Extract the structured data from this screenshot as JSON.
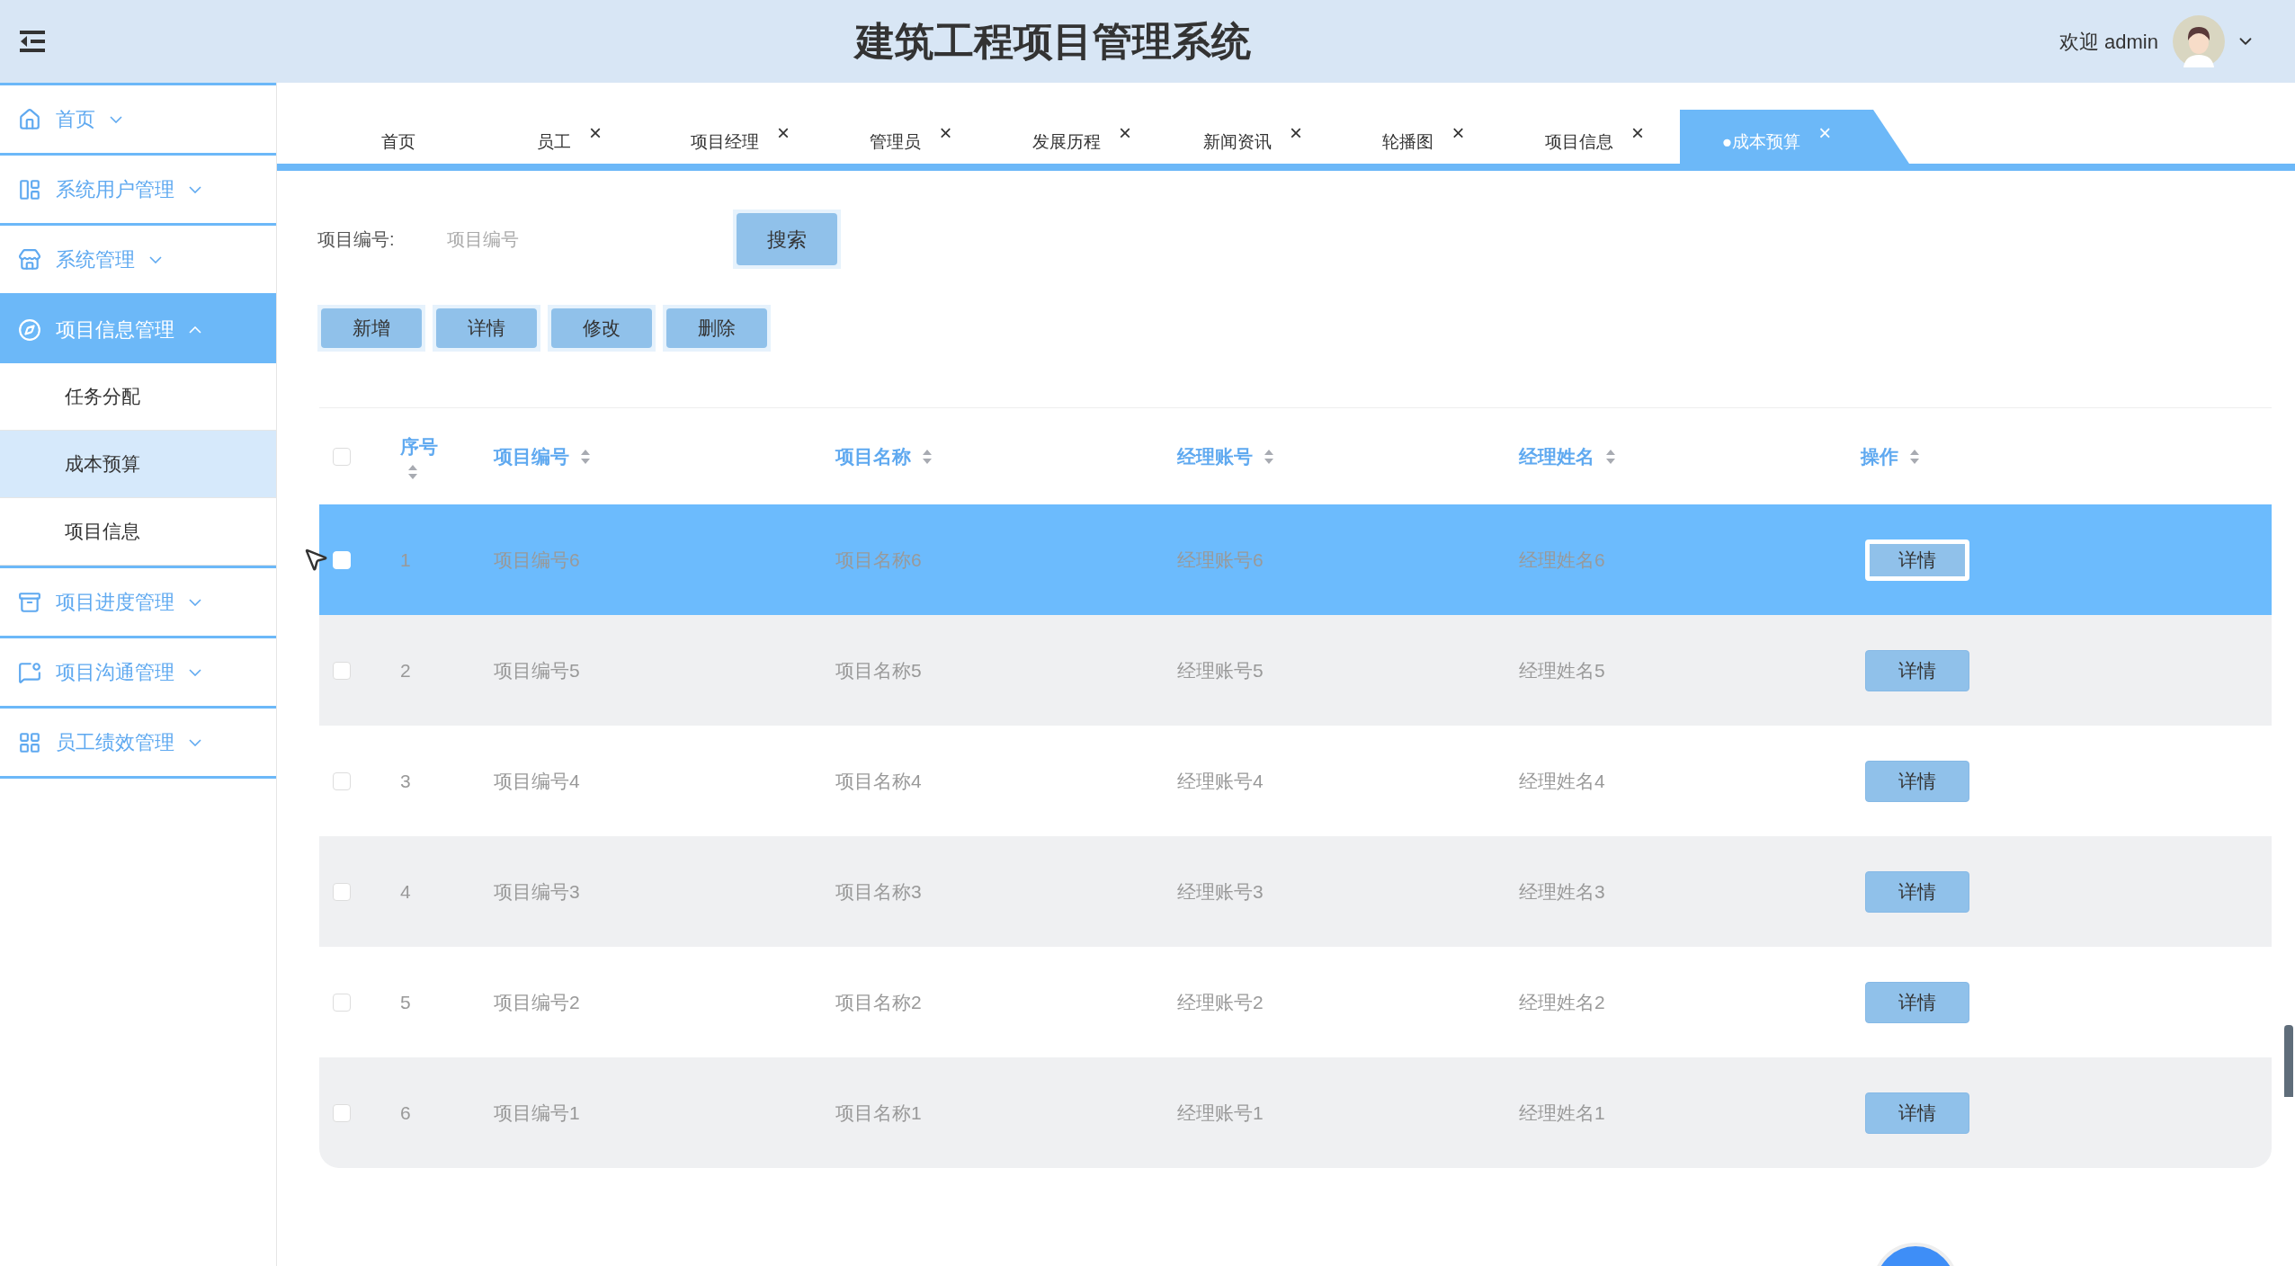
{
  "header": {
    "title": "建筑工程项目管理系统",
    "greeting": "欢迎 admin"
  },
  "sidebar": {
    "items": [
      {
        "label": "首页",
        "expanded": false
      },
      {
        "label": "系统用户管理",
        "expanded": false
      },
      {
        "label": "系统管理",
        "expanded": false
      },
      {
        "label": "项目信息管理",
        "expanded": true,
        "children": [
          {
            "label": "任务分配",
            "selected": false
          },
          {
            "label": "成本预算",
            "selected": true
          },
          {
            "label": "项目信息",
            "selected": false
          }
        ]
      },
      {
        "label": "项目进度管理",
        "expanded": false
      },
      {
        "label": "项目沟通管理",
        "expanded": false
      },
      {
        "label": "员工绩效管理",
        "expanded": false
      }
    ]
  },
  "tabs": [
    {
      "label": "首页",
      "closable": false,
      "selected": false
    },
    {
      "label": "员工",
      "closable": true,
      "selected": false
    },
    {
      "label": "项目经理",
      "closable": true,
      "selected": false
    },
    {
      "label": "管理员",
      "closable": true,
      "selected": false
    },
    {
      "label": "发展历程",
      "closable": true,
      "selected": false
    },
    {
      "label": "新闻资讯",
      "closable": true,
      "selected": false
    },
    {
      "label": "轮播图",
      "closable": true,
      "selected": false
    },
    {
      "label": "项目信息",
      "closable": true,
      "selected": false
    },
    {
      "label": "●成本预算",
      "closable": true,
      "selected": true
    }
  ],
  "close_glyph": "×",
  "search": {
    "label": "项目编号:",
    "placeholder": "项目编号",
    "button": "搜索"
  },
  "actions": [
    "新增",
    "详情",
    "修改",
    "删除"
  ],
  "table": {
    "all_checked": false,
    "columns": [
      "序号",
      "项目编号",
      "项目名称",
      "经理账号",
      "经理姓名",
      "操作"
    ],
    "rows": [
      {
        "cells": [
          "1",
          "项目编号6",
          "项目名称6",
          "经理账号6",
          "经理姓名6"
        ],
        "button": "详情",
        "selected": true
      },
      {
        "cells": [
          "2",
          "项目编号5",
          "项目名称5",
          "经理账号5",
          "经理姓名5"
        ],
        "button": "详情",
        "selected": false
      },
      {
        "cells": [
          "3",
          "项目编号4",
          "项目名称4",
          "经理账号4",
          "经理姓名4"
        ],
        "button": "详情",
        "selected": false
      },
      {
        "cells": [
          "4",
          "项目编号3",
          "项目名称3",
          "经理账号3",
          "经理姓名3"
        ],
        "button": "详情",
        "selected": false
      },
      {
        "cells": [
          "5",
          "项目编号2",
          "项目名称2",
          "经理账号2",
          "经理姓名2"
        ],
        "button": "详情",
        "selected": false
      },
      {
        "cells": [
          "6",
          "项目编号1",
          "项目名称1",
          "经理账号1",
          "经理姓名1"
        ],
        "button": "详情",
        "selected": false
      }
    ]
  }
}
